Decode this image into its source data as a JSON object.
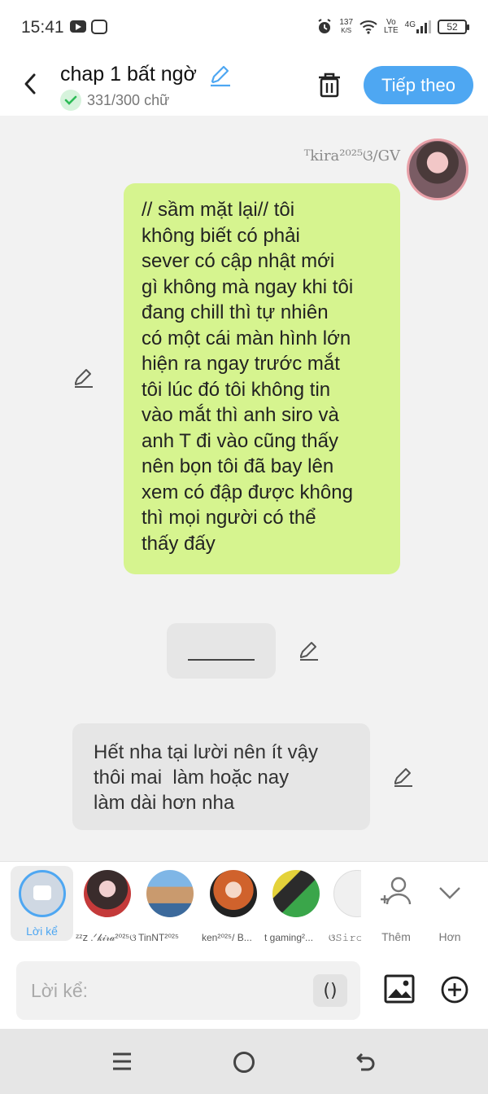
{
  "status_bar": {
    "time": "15:41",
    "net_speed": "137",
    "net_unit": "K/S",
    "volte_top": "Vo",
    "volte_bottom": "LTE",
    "network": "4G",
    "battery": "52"
  },
  "header": {
    "title": "chap 1 bất ngờ",
    "word_count": "331/300 chữ",
    "next_label": "Tiếp theo"
  },
  "messages": [
    {
      "author": "ᵀkira²⁰²⁵ଓ/GV",
      "text": "// sầm mặt lại// tôi\nkhông biết có phải\nsever có cập nhật mới\ngì không mà ngay khi tôi\nđang chill thì tự nhiên\ncó một cái màn hình lớn\nhiện ra ngay trước mắt\ntôi lúc đó tôi không tin\nvào mắt thì anh siro và\nanh T đi vào cũng thấy\nnên bọn tôi đã bay lên\nxem có đập được không\nthì mọi người có thể\nthấy đấy"
    },
    {
      "text": ""
    },
    {
      "text": "Hết nha tại lười nên ít vậy\nthôi mai  làm hoặc nay\nlàm dài hơn nha"
    }
  ],
  "characters": {
    "narrator_label": "Lời kể",
    "items": [
      {
        "name": "ᶻᶻ𝗓 .ᐟ𝓀𝒾𝓇𝒶²⁰²⁵ଓ"
      },
      {
        "name": "TinNT²⁰²⁵"
      },
      {
        "name": "ken²⁰²⁵/ B..."
      },
      {
        "name": "t gaming²..."
      },
      {
        "name": "ଓ𝚂𝚒𝚛𝚘"
      }
    ],
    "add_label": "Thêm",
    "more_label": "Hơn"
  },
  "composer": {
    "placeholder": "Lời kể:",
    "paren_label": "()"
  },
  "colors": {
    "accent": "#4ea7f2",
    "bubble_green": "#d6f48f",
    "bubble_gray": "#e6e6e6"
  }
}
